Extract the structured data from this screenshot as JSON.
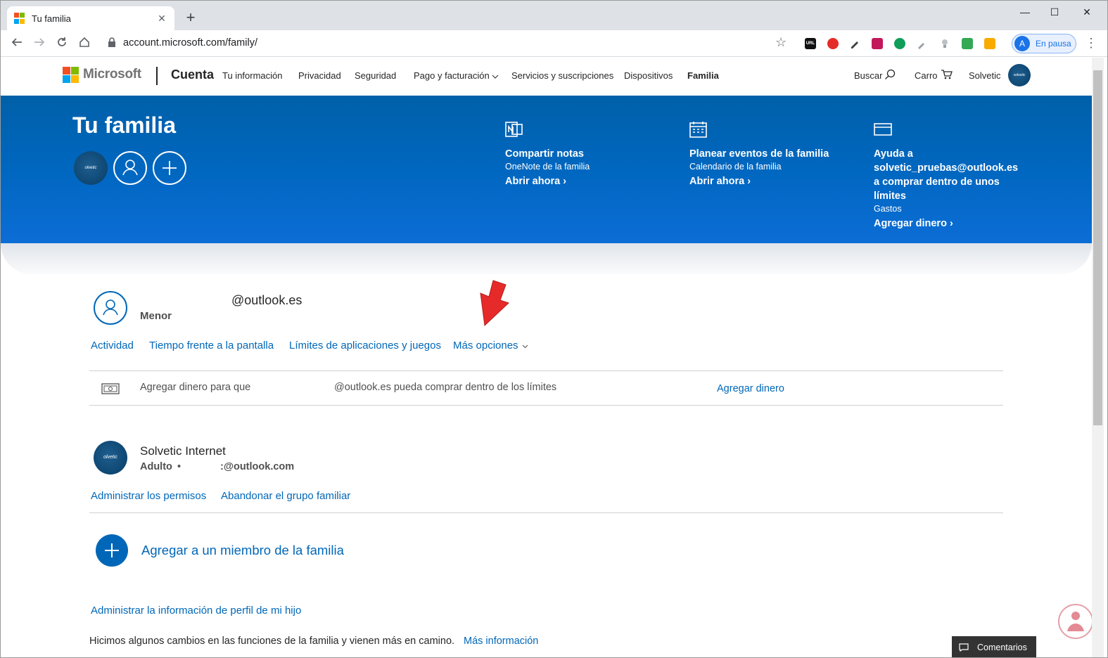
{
  "browser": {
    "tab_title": "Tu familia",
    "tab_close": "✕",
    "new_tab": "+",
    "url": "account.microsoft.com/family/",
    "profile_initial": "A",
    "profile_status": "En pausa",
    "ext_url_label": "URL",
    "window_controls": [
      "—",
      "☐",
      "✕"
    ]
  },
  "header": {
    "logo_text": "Microsoft",
    "section": "Cuenta",
    "nav": [
      "Tu información",
      "Privacidad",
      "Seguridad",
      "Pago y facturación",
      "Servicios y suscripciones",
      "Dispositivos",
      "Familia"
    ],
    "search": "Buscar",
    "cart": "Carro",
    "user": "Solvetic",
    "avatar_text": "solvetic"
  },
  "banner": {
    "title": "Tu familia",
    "member_avatar_text": "olvetic",
    "promos": [
      {
        "title": "Compartir notas",
        "subtitle": "OneNote de la familia",
        "link": "Abrir ahora"
      },
      {
        "title": "Planear eventos de la familia",
        "subtitle": "Calendario de la familia",
        "link": "Abrir ahora"
      },
      {
        "title_lines": [
          "Ayuda a",
          "solvetic_pruebas@outlook.es",
          "a comprar dentro de unos",
          "límites"
        ],
        "subtitle": "Gastos",
        "link": "Agregar dinero"
      }
    ]
  },
  "child": {
    "email": "@outlook.es",
    "role": "Menor",
    "links": [
      "Actividad",
      "Tiempo frente a la pantalla",
      "Límites de aplicaciones y juegos",
      "Más opciones"
    ],
    "money_left": "Agregar dinero para que",
    "money_right": "@outlook.es pueda comprar dentro de los límites",
    "money_link": "Agregar dinero"
  },
  "adult": {
    "name": "Solvetic Internet",
    "role": "Adulto",
    "bullet": "•",
    "email": ":@outlook.com",
    "avatar_text": "olvetic",
    "links": [
      "Administrar los permisos",
      "Abandonar el grupo familiar"
    ]
  },
  "add_member": "Agregar a un miembro de la familia",
  "manage_profile": "Administrar la información de perfil de mi hijo",
  "notice": "Hicimos algunos cambios en las funciones de la familia y vienen más en camino.",
  "notice_link": "Más información",
  "feedback": "Comentarios",
  "colors": {
    "banner": "#0067c0",
    "link": "#0067b8",
    "ms_red": "#f25022",
    "ms_green": "#7fba00",
    "ms_blue": "#00a4ef",
    "ms_yellow": "#ffb900"
  }
}
